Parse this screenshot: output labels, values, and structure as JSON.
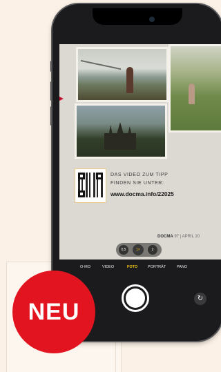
{
  "magazine": {
    "tip_line1": "DAS VIDEO ZUM TIPP",
    "tip_line2": "FINDEN SIE UNTER:",
    "tip_url": "www.docma.info/22025",
    "footer_brand": "DOCMA",
    "footer_issue": " 97 | APRIL 20"
  },
  "camera": {
    "zoom_levels": [
      "0,5",
      "1×",
      "2"
    ],
    "modes": [
      "O-MO",
      "VIDEO",
      "FOTO",
      "PORTRÄT",
      "PANO"
    ],
    "active_mode": "FOTO",
    "flip_icon": "↻"
  },
  "badge": {
    "label": "NEU",
    "color": "#e1141f"
  },
  "colors": {
    "accent_yellow": "#f5c518",
    "arrow_red": "#c8102e"
  }
}
